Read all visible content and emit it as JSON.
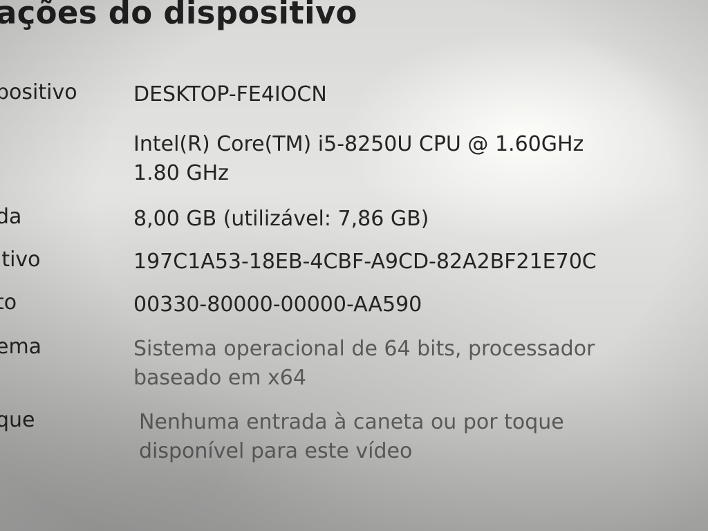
{
  "page_title": "ações do dispositivo",
  "specs": [
    {
      "label": "positivo",
      "value_lines": [
        "DESKTOP-FE4IOCN"
      ]
    },
    {
      "label": "",
      "value_lines": [
        "Intel(R) Core(TM) i5-8250U CPU @ 1.60GHz",
        "1.80 GHz"
      ]
    },
    {
      "label": "da",
      "value_lines": [
        "8,00 GB (utilizável: 7,86 GB)"
      ]
    },
    {
      "label": "itivo",
      "value_lines": [
        "197C1A53-18EB-4CBF-A9CD-82A2BF21E70C"
      ]
    },
    {
      "label": "to",
      "value_lines": [
        "00330-80000-00000-AA590"
      ]
    },
    {
      "label": "ema",
      "value_lines": [
        "Sistema operacional de 64 bits, processador",
        "baseado em x64"
      ]
    },
    {
      "label": "que",
      "value_lines": [
        "Nenhuma entrada à caneta ou por toque",
        "disponível para este vídeo"
      ]
    }
  ]
}
